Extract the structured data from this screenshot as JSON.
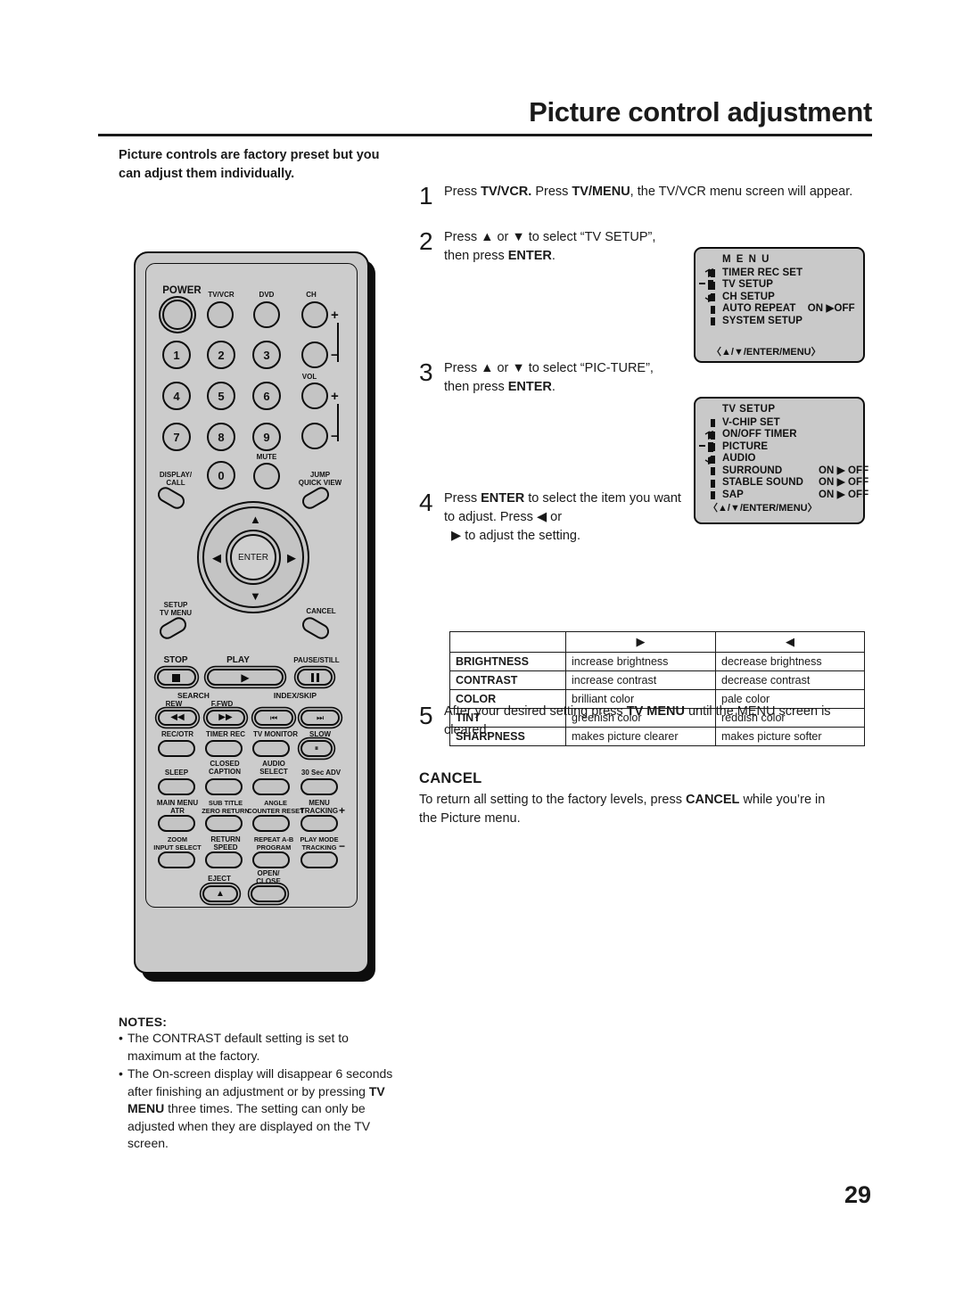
{
  "header": {
    "title": "Picture control adjustment"
  },
  "intro": {
    "text": "Picture controls are factory preset but you can adjust them individually."
  },
  "steps": [
    {
      "num": "1",
      "html": "Press <b>TV/VCR.</b> Press <b>TV/MENU</b>, the TV/VCR menu screen will appear."
    },
    {
      "num": "2",
      "html": "Press ▲ or ▼ to select “TV SETUP”, then press <b>ENTER</b>."
    },
    {
      "num": "3",
      "html": "Press ▲ or ▼ to select “PIC-TURE”, then press <b>ENTER</b>."
    },
    {
      "num": "4",
      "html": "Press <b>ENTER</b> to select the item you want to adjust. Press ◀ or<br>&nbsp;&nbsp;▶ to adjust the setting."
    },
    {
      "num": "5",
      "html": "After your desired setting press <b>TV MENU</b> until the MENU screen is cleared."
    }
  ],
  "osd_menu": {
    "title": "M E N U",
    "rows": [
      {
        "label": "TIMER REC SET",
        "value": ""
      },
      {
        "label": "TV SETUP",
        "value": ""
      },
      {
        "label": "CH SETUP",
        "value": ""
      },
      {
        "label": "AUTO REPEAT",
        "value": "ON ▶OFF"
      },
      {
        "label": "SYSTEM  SETUP",
        "value": ""
      }
    ],
    "footer": "〈▲/▼/ENTER/MENU〉"
  },
  "osd_tvsetup": {
    "title": "TV  SETUP",
    "rows": [
      {
        "label": "V-CHIP  SET",
        "value": ""
      },
      {
        "label": "ON/OFF  TIMER",
        "value": ""
      },
      {
        "label": "PICTURE",
        "value": ""
      },
      {
        "label": "AUDIO",
        "value": ""
      },
      {
        "label": "SURROUND",
        "value": "ON ▶ OFF"
      },
      {
        "label": "STABLE SOUND",
        "value": "ON ▶ OFF"
      },
      {
        "label": "SAP",
        "value": "ON ▶ OFF"
      }
    ],
    "footer": "〈▲/▼/ENTER/MENU〉"
  },
  "adjust_table": {
    "headers": [
      "",
      "▶",
      "◀"
    ],
    "rows": [
      [
        "BRIGHTNESS",
        "increase brightness",
        "decrease brightness"
      ],
      [
        "CONTRAST",
        "increase contrast",
        "decrease contrast"
      ],
      [
        "COLOR",
        "brilliant color",
        "pale color"
      ],
      [
        "TINT",
        "greenish color",
        "reddish color"
      ],
      [
        "SHARPNESS",
        "makes picture clearer",
        "makes picture softer"
      ]
    ]
  },
  "cancel_section": {
    "heading": "CANCEL",
    "body_html": "To return all setting to the factory levels, press <b>CANCEL</b> while you’re in the Picture menu."
  },
  "notes": {
    "heading": "NOTES:",
    "items_html": [
      "The CONTRAST default setting is set to maximum at the factory.",
      "The On-screen display will disappear 6 seconds after finishing an adjustment or by pressing <b>TV MENU</b> three times. The setting can only be adjusted when they are displayed on the TV screen."
    ]
  },
  "remote": {
    "labels": {
      "power": "POWER",
      "tvvcr": "TV/VCR",
      "dvd": "DVD",
      "ch": "CH",
      "vol": "VOL",
      "mute": "MUTE",
      "display_call": "DISPLAY/\nCALL",
      "jump_quickview": "JUMP\nQUICK VIEW",
      "setup_tvmenu": "SETUP\nTV MENU",
      "cancel": "CANCEL",
      "enter": "ENTER",
      "stop": "STOP",
      "play": "PLAY",
      "pause_still": "PAUSE/STILL",
      "search": "SEARCH",
      "rew": "REW",
      "ffwd": "F.FWD",
      "index_skip": "INDEX/SKIP",
      "rec_otr": "REC/OTR",
      "timer_rec": "TIMER REC",
      "tv_monitor": "TV MONITOR",
      "slow": "SLOW",
      "sleep": "SLEEP",
      "closed_caption": "CLOSED\nCAPTION",
      "audio_select": "AUDIO\nSELECT",
      "sec30_adv": "30 Sec ADV",
      "main_menu_atr": "MAIN MENU\nATR",
      "sub_title_zero": "SUB TITLE\nZERO RETURN",
      "angle_counter": "ANGLE\nCOUNTER RESET",
      "menu_tracking_plus": "MENU\nTRACKING",
      "zoom_input": "ZOOM\nINPUT SELECT",
      "return_speed": "RETURN\nSPEED",
      "repeat_program": "REPEAT A-B\nPROGRAM",
      "playmode_tracking_minus": "PLAY MODE\nTRACKING",
      "eject": "EJECT",
      "open_close": "OPEN/\nCLOSE",
      "plus": "+",
      "minus": "−",
      "numbers": [
        "1",
        "2",
        "3",
        "4",
        "5",
        "6",
        "7",
        "8",
        "9",
        "0"
      ]
    }
  },
  "page_number": "29",
  "colors": {
    "ink": "#1a1a1a",
    "remote_body": "#c9c9c9",
    "osd_bg": "#c9c9c9"
  }
}
